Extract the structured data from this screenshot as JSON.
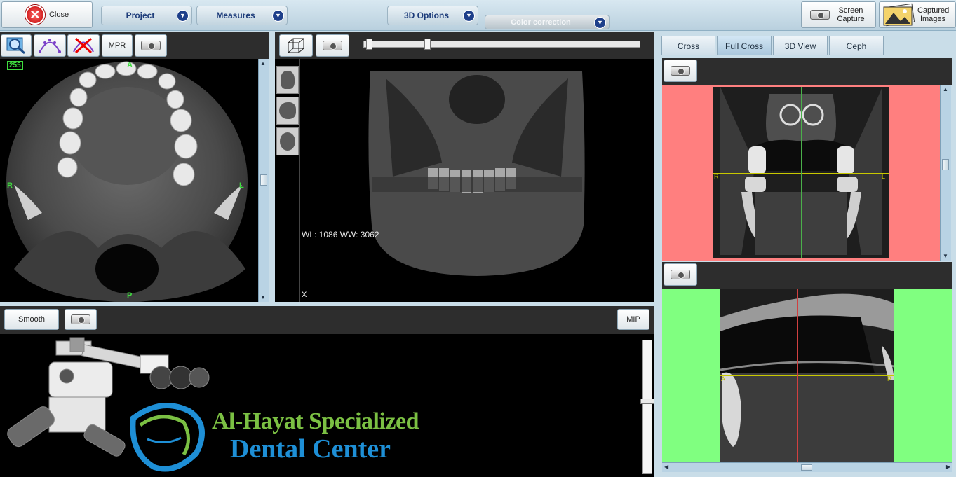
{
  "toolbar": {
    "close_label": "Close",
    "project_label": "Project",
    "measures_label": "Measures",
    "options3d_label": "3D Options",
    "color_correction_label": "Color correction",
    "screen_capture_label": "Screen Capture",
    "captured_images_label": "Captured Images"
  },
  "axial": {
    "mpr_label": "MPR",
    "slice_badge": "255",
    "orient_top": "A",
    "orient_bottom": "P",
    "orient_left": "R",
    "orient_right": "L"
  },
  "volume": {
    "window_text": "WL: 1086 WW: 3062",
    "corner_mark": "X"
  },
  "bottom": {
    "smooth_label": "Smooth",
    "mip_label": "MIP",
    "logo_line1": "Al-Hayat Specialized",
    "logo_line2": "Dental Center"
  },
  "right": {
    "tabs": [
      {
        "label": "Cross"
      },
      {
        "label": "Full Cross"
      },
      {
        "label": "3D View"
      },
      {
        "label": "Ceph"
      }
    ],
    "active_tab": "Full Cross",
    "cross_left_label": "R",
    "cross_right_label": "L",
    "sag_left_label": "A",
    "sag_right_label": "P"
  },
  "colors": {
    "coronal_bg": "#ff7f7f",
    "sagittal_bg": "#80ff80",
    "logo_green": "#7bc043",
    "logo_blue": "#1e8fd6"
  }
}
